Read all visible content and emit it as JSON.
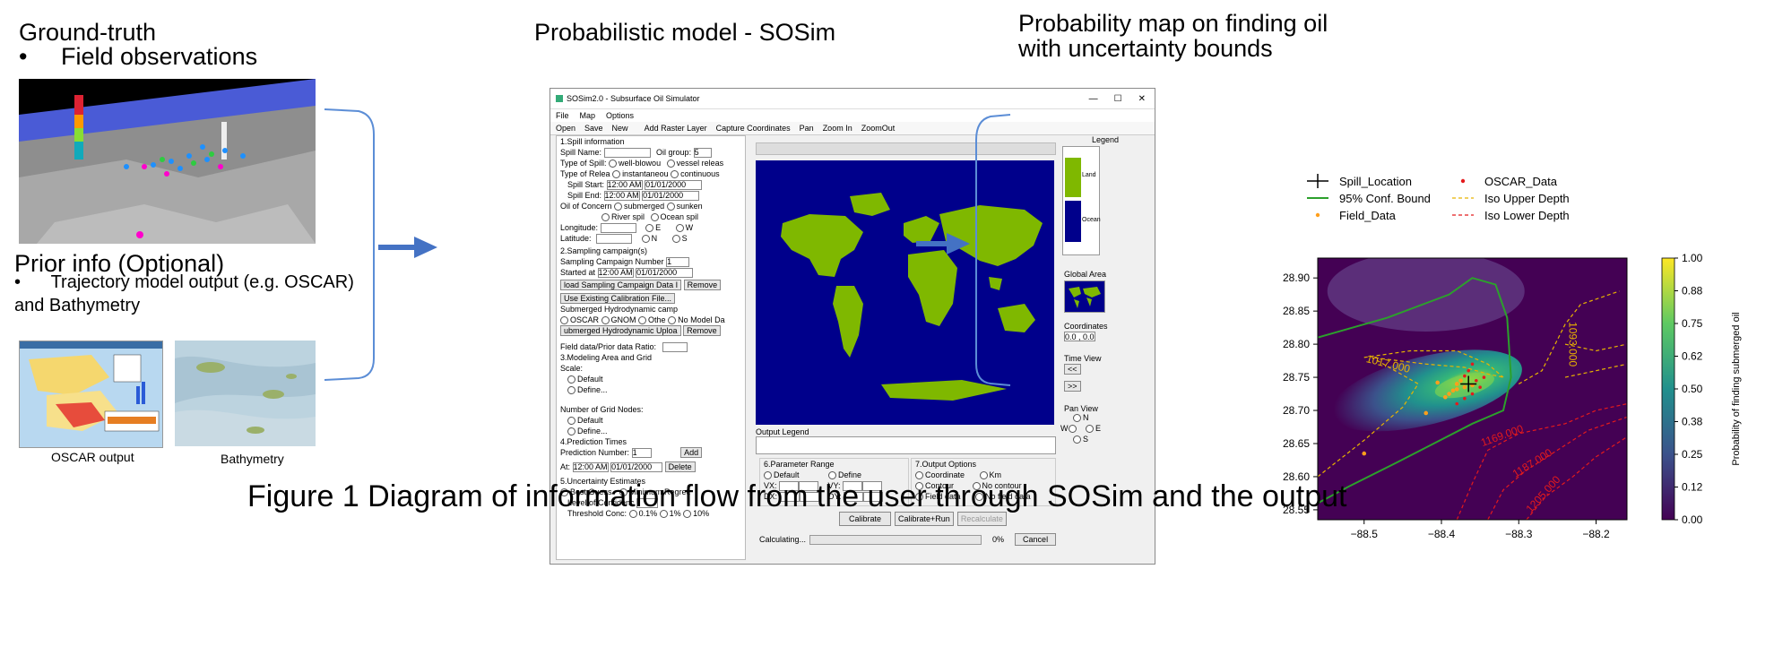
{
  "left": {
    "title": "Ground-truth",
    "bullet1": "Field observations",
    "prior_title": "Prior info (Optional)",
    "prior_bullet": "Trajectory model output (e.g. OSCAR)",
    "prior_cont": "and Bathymetry",
    "caption_oscar": "OSCAR output",
    "caption_bathy": "Bathymetry",
    "bullet_glyph": "•"
  },
  "middle": {
    "title": "Probabilistic model - SOSim"
  },
  "right": {
    "title_line1": "Probability map on finding oil",
    "title_line2": "with uncertainty bounds"
  },
  "figure_caption": "Figure 1 Diagram of information flow from the user through SOSim and the output",
  "sosim": {
    "window_title": "SOSim2.0 - Subsurface Oil Simulator",
    "win_controls": [
      "—",
      "☐",
      "✕"
    ],
    "menu": [
      "File",
      "Map",
      "Options"
    ],
    "toolbar": [
      "Open",
      "Save",
      "New",
      "Add Raster Layer",
      "Capture Coordinates",
      "Pan",
      "Zoom In",
      "ZoomOut"
    ],
    "s1": "1.Spill information",
    "spill_name": "Spill Name:",
    "oil_group": "Oil group:",
    "oil_group_val": "5",
    "type_spill": "Type of Spill:",
    "well_blowout": "well-blowou",
    "vessel": "vessel releas",
    "type_release": "Type of Relea",
    "instant": "instantaneou",
    "continuous": "continuous",
    "spill_start": "Spill Start:",
    "spill_end": "Spill End:",
    "time_val": "12:00 AM",
    "date_val": "01/01/2000",
    "oil_concern": "Oil of Concern",
    "submerged": "submerged",
    "sunken": "sunken",
    "river": "River spil",
    "ocean": "Ocean spil",
    "longitude": "Longitude:",
    "latitude": "Latitude:",
    "E": "E",
    "W": "W",
    "N": "N",
    "S": "S",
    "s2": "2.Sampling campaign(s)",
    "samp_num": "Sampling Campaign Number",
    "samp_num_val": "1",
    "started": "Started at",
    "load_btn": "load Sampling Campaign Data I",
    "remove": "Remove",
    "use_calib": "Use Existing Calibration File...",
    "submerged_hydro": "Submerged Hydrodynamic camp",
    "oscar": "OSCAR",
    "gnom": "GNOM",
    "other": "Othe",
    "no_model": "No Model Da",
    "upload_hydro": "ubmerged Hydrodynamic Uploa",
    "field_ratio": "Field data/Prior data Ratio:",
    "s3": "3.Modeling Area and Grid",
    "scale": "Scale:",
    "default": "Default",
    "define": "Define...",
    "grid_nodes": "Number of Grid Nodes:",
    "s4": "4.Prediction Times",
    "pred_num": "Prediction Number:",
    "add": "Add",
    "at": "At:",
    "delete": "Delete",
    "s5": "5.Uncertainty Estimates",
    "best_guess": "Best Guess",
    "min_regret": "Minimum Regret:",
    "level_conf": "Level of Confidenc",
    "threshold": "Threshold Conc:",
    "t01": "0.1%",
    "t1": "1%",
    "t10": "10%",
    "output_legend": "Output Legend",
    "s6": "6.Parameter Range",
    "define_r": "Define",
    "vx": "VX:",
    "vy": "VY:",
    "dx": "DX:",
    "dy": "DY:",
    "s7": "7.Output Options",
    "coordinate": "Coordinate",
    "km": "Km",
    "contour": "Contour",
    "no_contour": "No contour",
    "field_data": "Field data",
    "no_field": "No field data",
    "calibrate": "Calibrate",
    "calib_run": "Calibrate+Run",
    "recalc": "Recalculate",
    "calculating": "Calculating...",
    "pct": "0%",
    "cancel": "Cancel",
    "legend": "Legend",
    "land": "Land",
    "ocean_l": "Ocean",
    "global_area": "Global Area",
    "coordinates": "Coordinates",
    "coord_val": "0.0 ,  0.0",
    "time_view": "Time View",
    "prev": "<<",
    "next": ">>",
    "pan_view": "Pan View",
    "colors": {
      "land": "#7fb800",
      "ocean": "#00008b"
    }
  },
  "chart_data": {
    "type": "heatmap",
    "xlabel": "",
    "ylabel": "",
    "xlim": [
      -88.56,
      -88.16
    ],
    "ylim": [
      28.535,
      28.93
    ],
    "xticks": [
      "−88.5",
      "−88.4",
      "−88.3",
      "−88.2"
    ],
    "xtick_values": [
      -88.5,
      -88.4,
      -88.3,
      -88.2
    ],
    "yticks": [
      "28.55",
      "28.60",
      "28.65",
      "28.70",
      "28.75",
      "28.80",
      "28.85",
      "28.90"
    ],
    "ytick_values": [
      28.55,
      28.6,
      28.65,
      28.7,
      28.75,
      28.8,
      28.85,
      28.9
    ],
    "colorbar_label": "Probability of finding submerged oil",
    "colorbar_ticks": [
      "0.00",
      "0.12",
      "0.25",
      "0.38",
      "0.50",
      "0.62",
      "0.75",
      "0.88",
      "1.00"
    ],
    "legend": [
      {
        "label": "Spill_Location",
        "style": "plus",
        "color": "#000000"
      },
      {
        "label": "OSCAR_Data",
        "style": "dot",
        "color": "#e41a1c"
      },
      {
        "label": "95% Conf. Bound",
        "style": "line",
        "color": "#2ca02c"
      },
      {
        "label": "Iso Upper Depth",
        "style": "dash",
        "color": "#e8b400"
      },
      {
        "label": "Field_Data",
        "style": "dot",
        "color": "#ff9f1c"
      },
      {
        "label": "Iso Lower Depth",
        "style": "dash",
        "color": "#e41a1c"
      }
    ],
    "spill_location": {
      "x": -88.365,
      "y": 28.74
    },
    "field_data": [
      {
        "x": -88.37,
        "y": 28.735
      },
      {
        "x": -88.38,
        "y": 28.74
      },
      {
        "x": -88.385,
        "y": 28.73
      },
      {
        "x": -88.39,
        "y": 28.725
      },
      {
        "x": -88.375,
        "y": 28.745
      },
      {
        "x": -88.395,
        "y": 28.72
      },
      {
        "x": -88.36,
        "y": 28.738
      },
      {
        "x": -88.405,
        "y": 28.742
      },
      {
        "x": -88.42,
        "y": 28.696
      },
      {
        "x": -88.5,
        "y": 28.635
      },
      {
        "x": -88.38,
        "y": 28.732
      }
    ],
    "oscar_data": [
      {
        "x": -88.36,
        "y": 28.77
      },
      {
        "x": -88.365,
        "y": 28.76
      },
      {
        "x": -88.37,
        "y": 28.752
      },
      {
        "x": -88.355,
        "y": 28.745
      },
      {
        "x": -88.36,
        "y": 28.725
      },
      {
        "x": -88.37,
        "y": 28.718
      },
      {
        "x": -88.35,
        "y": 28.735
      },
      {
        "x": -88.38,
        "y": 28.71
      },
      {
        "x": -88.345,
        "y": 28.75
      }
    ],
    "contour_labels": [
      {
        "text": "1017.000",
        "color": "#e8b400",
        "x": -88.47,
        "y": 28.765,
        "angle": 14
      },
      {
        "text": "1093.000",
        "color": "#e8b400",
        "x": -88.235,
        "y": 28.8,
        "angle": 90
      },
      {
        "text": "1169.000",
        "color": "#e41a1c",
        "x": -88.32,
        "y": 28.657,
        "angle": -20
      },
      {
        "text": "1187.000",
        "color": "#e41a1c",
        "x": -88.28,
        "y": 28.616,
        "angle": -32
      },
      {
        "text": "1205.000",
        "color": "#e41a1c",
        "x": -88.265,
        "y": 28.57,
        "angle": -48
      }
    ]
  }
}
